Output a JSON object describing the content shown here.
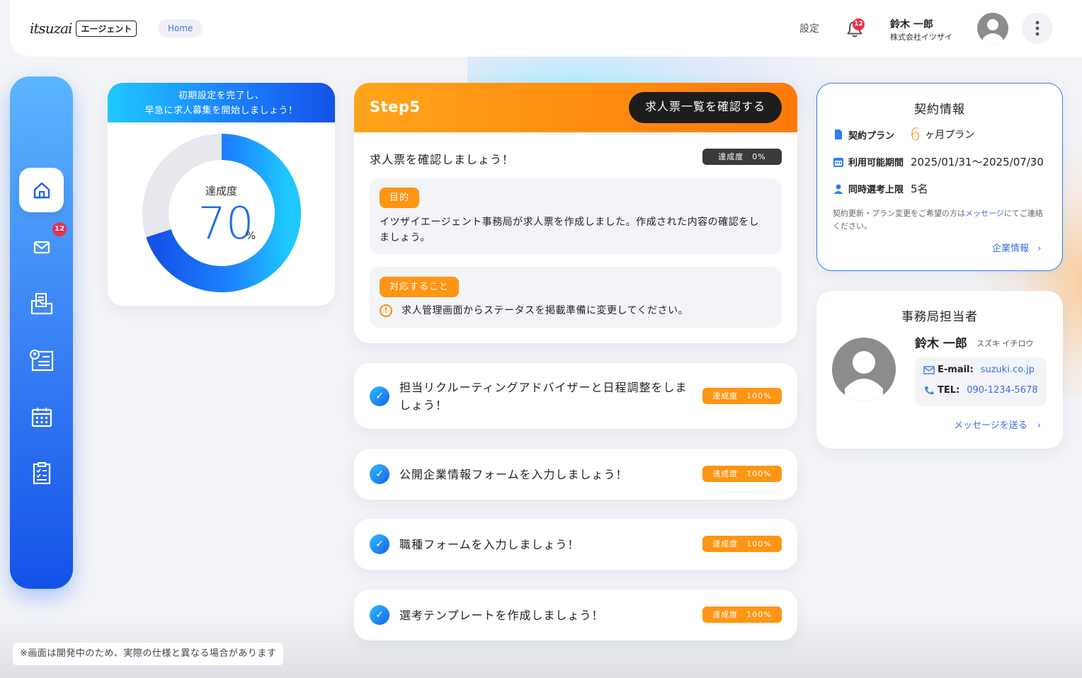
{
  "header": {
    "logo_script": "itsuzai",
    "logo_box": "エージェント",
    "breadcrumb": "Home",
    "settings_label": "設定",
    "notification_count": "12",
    "user_name": "鈴木 一郎",
    "user_company": "株式会社イツザイ"
  },
  "sidebar": {
    "items": [
      {
        "name": "home",
        "icon": "home-icon",
        "active": true
      },
      {
        "name": "messages",
        "icon": "mail-icon",
        "badge": "12"
      },
      {
        "name": "documents",
        "icon": "folder-icon"
      },
      {
        "name": "candidates",
        "icon": "profile-card-icon"
      },
      {
        "name": "calendar",
        "icon": "calendar-icon"
      },
      {
        "name": "tasks",
        "icon": "checklist-icon"
      }
    ],
    "mail_badge": "12"
  },
  "progress": {
    "heading_line1": "初期設定を完了し、",
    "heading_line2": "早急に求人募集を開始しましょう！",
    "label": "達成度",
    "value": "70",
    "unit": "%",
    "percent": 70
  },
  "step": {
    "title": "Step5",
    "button_label": "求人票一覧を確認する",
    "question": "求人票を確認しましょう！",
    "rate": "達成度　0%",
    "purpose_tag": "目的",
    "purpose_text": "イツザイエージェント事務局が求人票を作成しました。作成された内容の確認をしましょう。",
    "todo_tag": "対応すること",
    "todo_text": "求人管理画面からステータスを掲載準備に変更してください。"
  },
  "tasks": [
    {
      "text": "担当リクルーティングアドバイザーと日程調整をしましょう！",
      "rate": "達成度　100%"
    },
    {
      "text": "公開企業情報フォームを入力しましょう！",
      "rate": "達成度　100%"
    },
    {
      "text": "職種フォームを入力しましょう！",
      "rate": "達成度　100%"
    },
    {
      "text": "選考テンプレートを作成しましょう！",
      "rate": "達成度　100%"
    }
  ],
  "contract": {
    "title": "契約情報",
    "plan_label": "契約プラン",
    "plan_number": "6",
    "plan_unit": "ヶ月プラン",
    "period_label": "利用可能期間",
    "period_value": "2025/01/31〜2025/07/30",
    "limit_label": "同時選考上限",
    "limit_value": "5名",
    "note_prefix": "契約更新・プラン変更をご希望の方は",
    "note_link": "メッセージ",
    "note_suffix": "にてご連絡ください。",
    "link_label": "企業情報"
  },
  "staff": {
    "title": "事務局担当者",
    "name": "鈴木 一郎",
    "kana": "スズキ イチロウ",
    "email_label": "E-mail:",
    "email_value": "suzuki.co.jp",
    "tel_label": "TEL:",
    "tel_value": "090-1234-5678",
    "link_label": "メッセージを送る"
  },
  "footnote": "※画面は開発中のため、実際の仕様と異なる場合があります",
  "colors": {
    "accent_blue": "#1b6cf0",
    "accent_orange": "#ff9514",
    "badge_red": "#e8304a"
  }
}
